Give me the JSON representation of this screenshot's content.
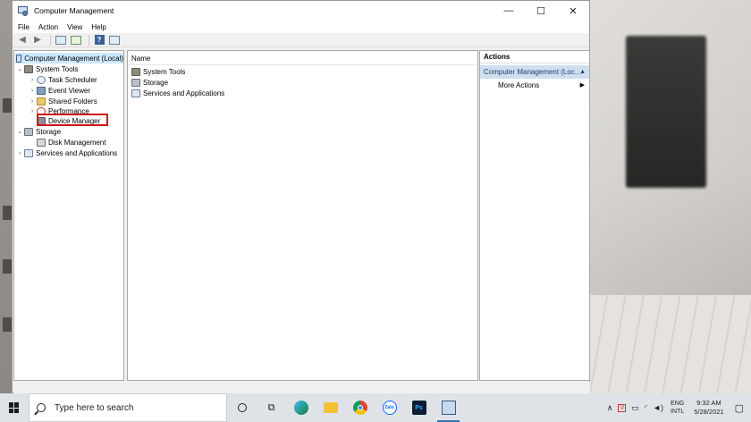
{
  "window": {
    "title": "Computer Management",
    "controls": {
      "minimize": "—",
      "maximize": "☐",
      "close": "✕"
    }
  },
  "menu": [
    "File",
    "Action",
    "View",
    "Help"
  ],
  "toolbar": {
    "help_label": "?"
  },
  "tree": {
    "root": "Computer Management (Local)",
    "system_tools": "System Tools",
    "task_scheduler": "Task Scheduler",
    "event_viewer": "Event Viewer",
    "shared_folders": "Shared Folders",
    "performance": "Performance",
    "device_manager": "Device Manager",
    "storage": "Storage",
    "disk_management": "Disk Management",
    "services_and_applications": "Services and Applications"
  },
  "main": {
    "column_name": "Name",
    "rows": [
      "System Tools",
      "Storage",
      "Services and Applications"
    ]
  },
  "actions": {
    "header": "Actions",
    "section": "Computer Management (Loc...",
    "more_actions": "More Actions"
  },
  "taskbar": {
    "search_placeholder": "Type here to search",
    "apps": [
      "Task View",
      "Edge",
      "File Explorer",
      "Chrome",
      "Zalo",
      "Photoshop",
      "Computer Management"
    ],
    "zalo_label": "Zalo",
    "ps_label": "Ps",
    "lang_top": "ENG",
    "lang_bottom": "INTL",
    "time": "9:32 AM",
    "date": "5/28/2021"
  },
  "colors": {
    "selection": "#cce8ff",
    "highlight_box": "#d1141a",
    "actions_section": "#cfdff0"
  }
}
